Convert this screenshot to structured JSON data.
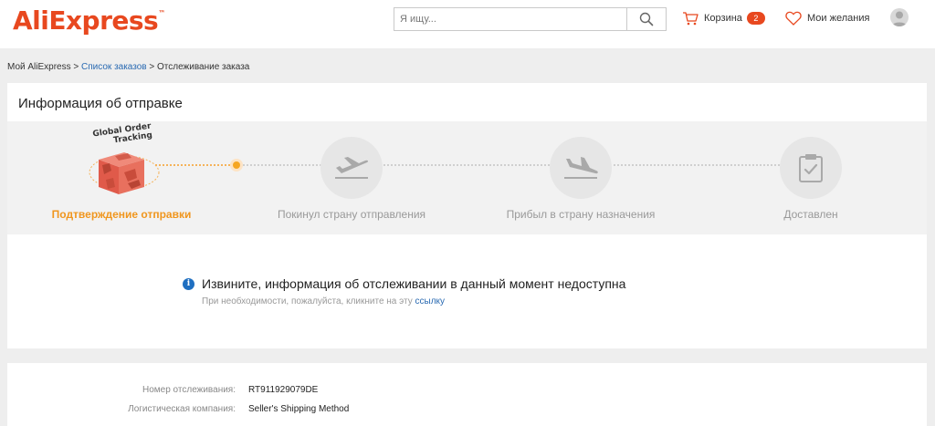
{
  "header": {
    "logo_text": "AliExpress",
    "logo_tm": "™",
    "brand_color": "#e8481f",
    "search": {
      "placeholder": "Я ищу...",
      "value": ""
    },
    "cart": {
      "label": "Корзина",
      "count": "2"
    },
    "wishlist": {
      "label": "Мои желания"
    }
  },
  "breadcrumb": {
    "home": "Мой AliExpress",
    "sep1": " > ",
    "orders": "Список заказов",
    "sep2": " > ",
    "current": "Отслеживание заказа"
  },
  "shipping": {
    "title": "Информация об отправке",
    "badge_line1": "Global Order",
    "badge_line2": "Tracking",
    "steps": [
      {
        "label": "Подтверждение отправки",
        "icon": "package-icon",
        "active": true
      },
      {
        "label": "Покинул страну отправления",
        "icon": "plane-takeoff-icon",
        "active": false
      },
      {
        "label": "Прибыл в страну назначения",
        "icon": "plane-landing-icon",
        "active": false
      },
      {
        "label": "Доставлен",
        "icon": "clipboard-check-icon",
        "active": false
      }
    ],
    "accent_color": "#f0961e"
  },
  "notice": {
    "title": "Извините, информация об отслеживании в данный момент недоступна",
    "subtitle": "При необходимости, пожалуйста, кликните на эту ",
    "link": "ссылку"
  },
  "details": {
    "rows": [
      {
        "key": "Номер отслеживания:",
        "value": "RT911929079DE"
      },
      {
        "key": "Логистическая компания:",
        "value": "Seller's Shipping Method"
      }
    ]
  }
}
